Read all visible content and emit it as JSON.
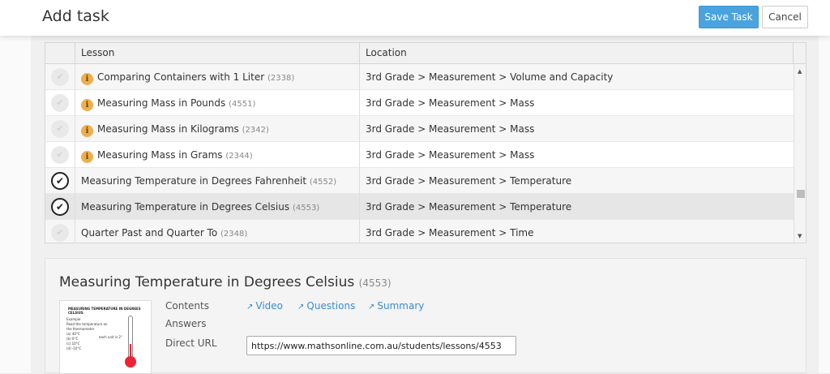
{
  "header": {
    "title": "Add task",
    "save_label": "Save Task",
    "cancel_label": "Cancel"
  },
  "table": {
    "columns": {
      "lesson": "Lesson",
      "location": "Location"
    },
    "rows": [
      {
        "title": "Comparing Containers with 1 Liter",
        "code": "(2338)",
        "location": "3rd Grade > Measurement > Volume and Capacity",
        "info": true,
        "checked": false
      },
      {
        "title": "Measuring Mass in Pounds",
        "code": "(4551)",
        "location": "3rd Grade > Measurement > Mass",
        "info": true,
        "checked": false
      },
      {
        "title": "Measuring Mass in Kilograms",
        "code": "(2342)",
        "location": "3rd Grade > Measurement > Mass",
        "info": true,
        "checked": false
      },
      {
        "title": "Measuring Mass in Grams",
        "code": "(2344)",
        "location": "3rd Grade > Measurement > Mass",
        "info": true,
        "checked": false
      },
      {
        "title": "Measuring Temperature in Degrees Fahrenheit",
        "code": "(4552)",
        "location": "3rd Grade > Measurement > Temperature",
        "info": false,
        "checked": true
      },
      {
        "title": "Measuring Temperature in Degrees Celsius",
        "code": "(4553)",
        "location": "3rd Grade > Measurement > Temperature",
        "info": false,
        "checked": true
      },
      {
        "title": "Quarter Past and Quarter To",
        "code": "(2348)",
        "location": "3rd Grade > Measurement > Time",
        "info": false,
        "checked": false
      }
    ]
  },
  "detail": {
    "title": "Measuring Temperature in Degrees Celsius",
    "code": "(4553)",
    "contents_label": "Contents",
    "answers_label": "Answers",
    "url_label": "Direct URL",
    "video_link": "Video",
    "questions_link": "Questions",
    "summary_link": "Summary",
    "url_value": "https://www.mathsonline.com.au/students/lessons/4553",
    "thumb": {
      "heading": "MEASURING TEMPERATURE IN DEGREES CELSIUS",
      "example": "Example",
      "line1": "Read the temperature on",
      "line2": "the thermometer",
      "a": "(a) 40°C",
      "b": "(b) 0°C",
      "c": "(c) 10°C",
      "d": "(d) -10°C",
      "each": "each unit is 2°"
    }
  },
  "icons": {
    "info": "info-icon",
    "check": "check-icon",
    "external": "external-link-icon"
  },
  "colors": {
    "primary": "#4aa3df",
    "info_badge": "#f0ad4e",
    "link": "#3a8dd0"
  }
}
